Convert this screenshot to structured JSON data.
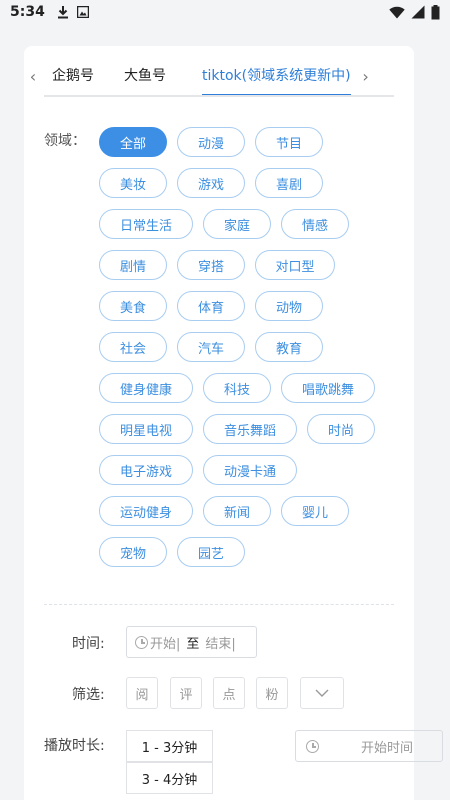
{
  "status_bar": {
    "time": "5:34",
    "icons": [
      "download-icon",
      "image-icon",
      "wifi-icon",
      "signal-icon",
      "battery-icon"
    ]
  },
  "tabs": {
    "prev_arrow": "‹",
    "next_arrow": "›",
    "items": [
      "企鹅号",
      "大鱼号",
      "tiktok(领域系统更新中)"
    ],
    "active_index": 2
  },
  "domain": {
    "label": "领域：",
    "selected": "全部",
    "rows": [
      [
        "全部",
        "动漫",
        "节目"
      ],
      [
        "美妆",
        "游戏",
        "喜剧"
      ],
      [
        "日常生活",
        "家庭",
        "情感"
      ],
      [
        "剧情",
        "穿搭",
        "对口型"
      ],
      [
        "美食",
        "体育",
        "动物"
      ],
      [
        "社会",
        "汽车",
        "教育"
      ],
      [
        "健身健康",
        "科技",
        "唱歌跳舞"
      ],
      [
        "明星电视",
        "音乐舞蹈",
        "时尚"
      ],
      [
        "电子游戏",
        "动漫卡通"
      ],
      [
        "运动健身",
        "新闻",
        "婴儿"
      ],
      [
        "宠物",
        "园艺"
      ]
    ]
  },
  "time_filter": {
    "label": "时间:",
    "start_placeholder": "开始|",
    "separator": "至",
    "end_placeholder": "结束|"
  },
  "screen_filter": {
    "label": "筛选:",
    "options": [
      "阅",
      "评",
      "点",
      "粉"
    ]
  },
  "duration": {
    "label": "播放时长:",
    "options": [
      "1 - 3分钟",
      "3 - 4分钟"
    ],
    "start_time_placeholder": "开始时间"
  },
  "colors": {
    "accent": "#3d8fe6",
    "chip_border": "#a9cdf1",
    "tab_active": "#2f7fd8"
  }
}
